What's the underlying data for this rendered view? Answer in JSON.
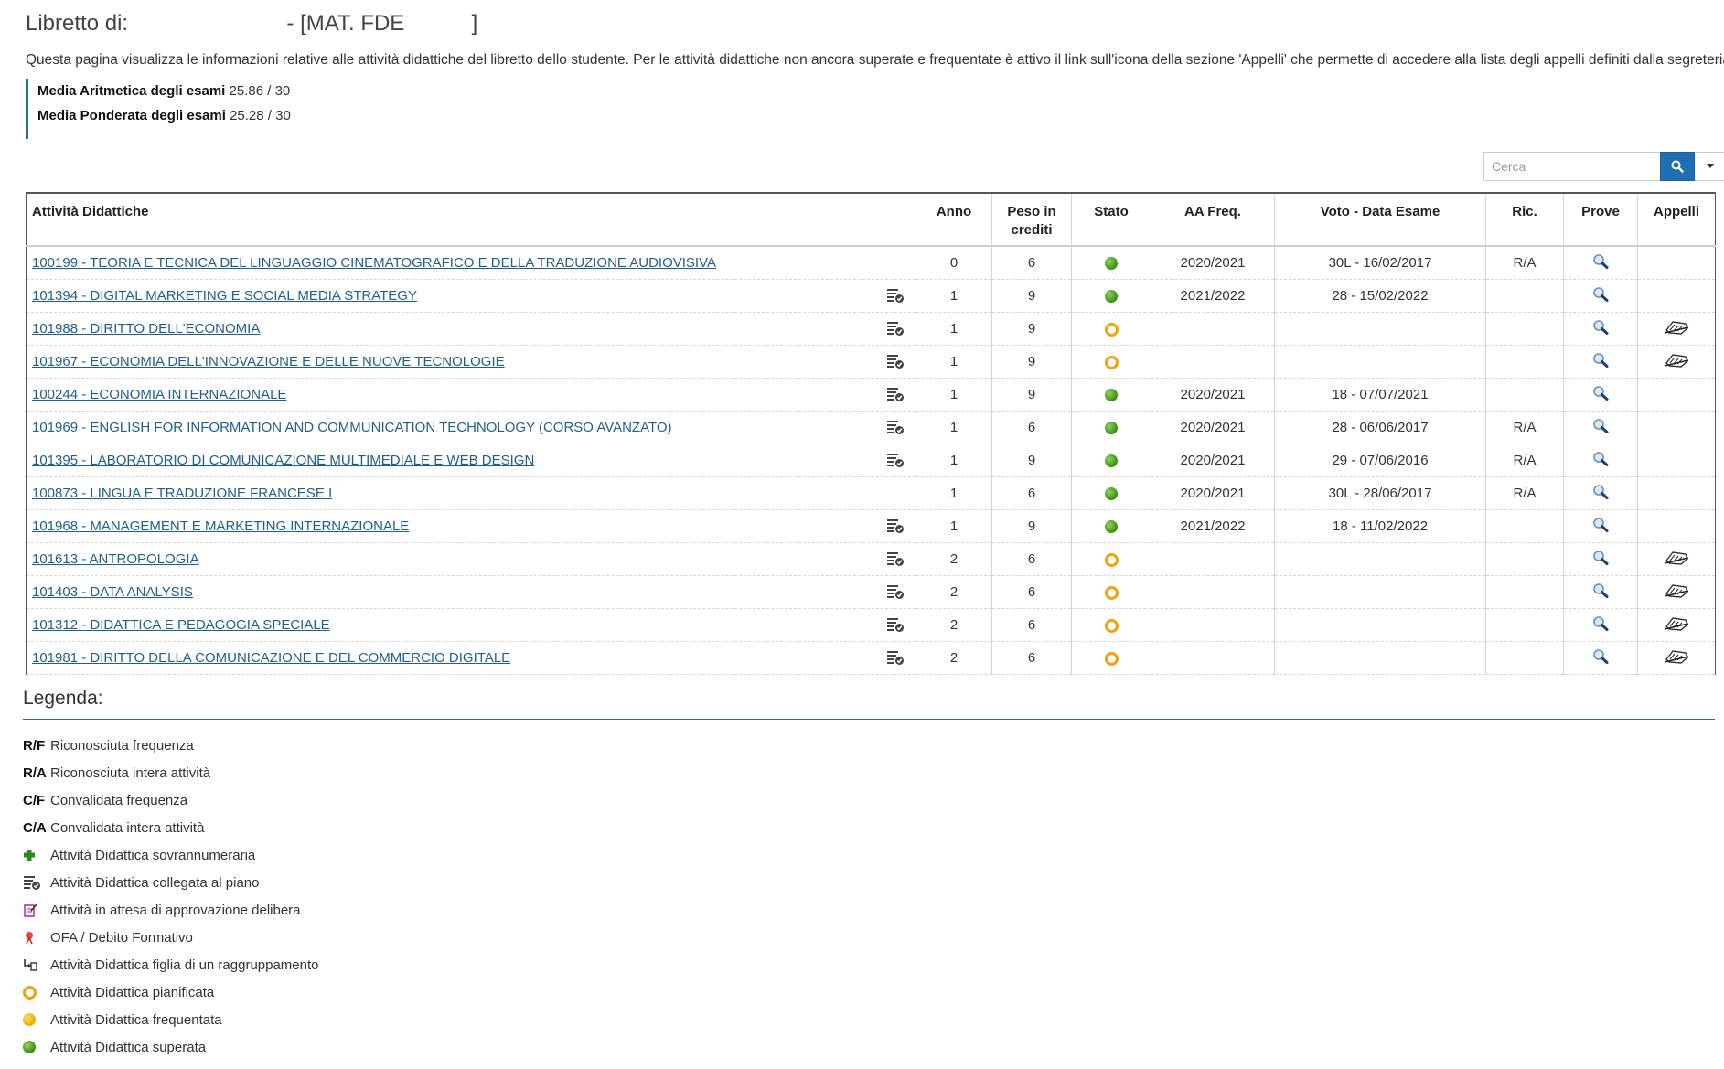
{
  "header": {
    "title": "Libretto di:                          - [MAT. FDE           ]",
    "intro": "Questa pagina visualizza le informazioni relative alle attività didattiche del libretto dello studente. Per le attività didattiche non ancora superate e frequentate è attivo il link sull'icona della sezione 'Appelli' che permette di accedere alla lista degli appelli definiti dalla segreteria didattica."
  },
  "averages": {
    "arith_label": "Media Aritmetica degli esami",
    "arith_value": "25.86 / 30",
    "weighted_label": "Media Ponderata degli esami",
    "weighted_value": "25.28 / 30"
  },
  "search": {
    "placeholder": "Cerca"
  },
  "table": {
    "columns": [
      "Attività Didattiche",
      "Anno",
      "Peso in crediti",
      "Stato",
      "AA Freq.",
      "Voto - Data Esame",
      "Ric.",
      "Prove",
      "Appelli"
    ],
    "rows": [
      {
        "name": "100199 - TEORIA E TECNICA DEL LINGUAGGIO CINEMATOGRAFICO E DELLA TRADUZIONE AUDIOVISIVA",
        "plan": false,
        "anno": "0",
        "peso": "6",
        "stato": "superata",
        "aa": "2020/2021",
        "voto": "30L - 16/02/2017",
        "ric": "R/A",
        "appelli": false
      },
      {
        "name": "101394 - DIGITAL MARKETING E SOCIAL MEDIA STRATEGY",
        "plan": true,
        "anno": "1",
        "peso": "9",
        "stato": "superata",
        "aa": "2021/2022",
        "voto": "28 - 15/02/2022",
        "ric": "",
        "appelli": false
      },
      {
        "name": "101988 - DIRITTO DELL'ECONOMIA",
        "plan": true,
        "anno": "1",
        "peso": "9",
        "stato": "pianificata",
        "aa": "",
        "voto": "",
        "ric": "",
        "appelli": true
      },
      {
        "name": "101967 - ECONOMIA DELL'INNOVAZIONE E DELLE NUOVE TECNOLOGIE",
        "plan": true,
        "anno": "1",
        "peso": "9",
        "stato": "pianificata",
        "aa": "",
        "voto": "",
        "ric": "",
        "appelli": true
      },
      {
        "name": "100244 - ECONOMIA INTERNAZIONALE",
        "plan": true,
        "anno": "1",
        "peso": "9",
        "stato": "superata",
        "aa": "2020/2021",
        "voto": "18 - 07/07/2021",
        "ric": "",
        "appelli": false
      },
      {
        "name": "101969 - ENGLISH FOR INFORMATION AND COMMUNICATION TECHNOLOGY (CORSO AVANZATO)",
        "plan": true,
        "anno": "1",
        "peso": "6",
        "stato": "superata",
        "aa": "2020/2021",
        "voto": "28 - 06/06/2017",
        "ric": "R/A",
        "appelli": false
      },
      {
        "name": "101395 - LABORATORIO DI COMUNICAZIONE MULTIMEDIALE E WEB DESIGN",
        "plan": true,
        "anno": "1",
        "peso": "9",
        "stato": "superata",
        "aa": "2020/2021",
        "voto": "29 - 07/06/2016",
        "ric": "R/A",
        "appelli": false
      },
      {
        "name": "100873 - LINGUA E TRADUZIONE FRANCESE I",
        "plan": false,
        "anno": "1",
        "peso": "6",
        "stato": "superata",
        "aa": "2020/2021",
        "voto": "30L - 28/06/2017",
        "ric": "R/A",
        "appelli": false
      },
      {
        "name": "101968 - MANAGEMENT E MARKETING INTERNAZIONALE",
        "plan": true,
        "anno": "1",
        "peso": "9",
        "stato": "superata",
        "aa": "2021/2022",
        "voto": "18 - 11/02/2022",
        "ric": "",
        "appelli": false
      },
      {
        "name": "101613 - ANTROPOLOGIA",
        "plan": true,
        "anno": "2",
        "peso": "6",
        "stato": "pianificata",
        "aa": "",
        "voto": "",
        "ric": "",
        "appelli": true
      },
      {
        "name": "101403 - DATA ANALYSIS",
        "plan": true,
        "anno": "2",
        "peso": "6",
        "stato": "pianificata",
        "aa": "",
        "voto": "",
        "ric": "",
        "appelli": true
      },
      {
        "name": "101312 - DIDATTICA E PEDAGOGIA SPECIALE",
        "plan": true,
        "anno": "2",
        "peso": "6",
        "stato": "pianificata",
        "aa": "",
        "voto": "",
        "ric": "",
        "appelli": true
      },
      {
        "name": "101981 - DIRITTO DELLA COMUNICAZIONE E DEL COMMERCIO DIGITALE",
        "plan": true,
        "anno": "2",
        "peso": "6",
        "stato": "pianificata",
        "aa": "",
        "voto": "",
        "ric": "",
        "appelli": true
      }
    ]
  },
  "legend": {
    "title": "Legenda:",
    "items": [
      {
        "key": "R/F",
        "icon": "",
        "text": "Riconosciuta frequenza"
      },
      {
        "key": "R/A",
        "icon": "",
        "text": "Riconosciuta intera attività"
      },
      {
        "key": "C/F",
        "icon": "",
        "text": "Convalidata frequenza"
      },
      {
        "key": "C/A",
        "icon": "",
        "text": "Convalidata intera attività"
      },
      {
        "key": "",
        "icon": "plus-icon",
        "text": "Attività Didattica sovrannumeraria"
      },
      {
        "key": "",
        "icon": "plan-linked-icon",
        "text": "Attività Didattica collegata al piano"
      },
      {
        "key": "",
        "icon": "pending-approval-icon",
        "text": "Attività in attesa di approvazione delibera"
      },
      {
        "key": "",
        "icon": "ofa-icon",
        "text": "OFA / Debito Formativo"
      },
      {
        "key": "",
        "icon": "child-group-icon",
        "text": "Attività Didattica figlia di un raggruppamento"
      },
      {
        "key": "",
        "icon": "planned-status-icon",
        "text": "Attività Didattica pianificata"
      },
      {
        "key": "",
        "icon": "attended-status-icon",
        "text": "Attività Didattica frequentata"
      },
      {
        "key": "",
        "icon": "passed-status-icon",
        "text": "Attività Didattica superata"
      }
    ]
  },
  "colors": {
    "link": "#1f5f8b",
    "accent": "#2d6a8f",
    "button": "#1f6fb5",
    "planned": "#f0a20a",
    "passed": "#3a8d12"
  }
}
